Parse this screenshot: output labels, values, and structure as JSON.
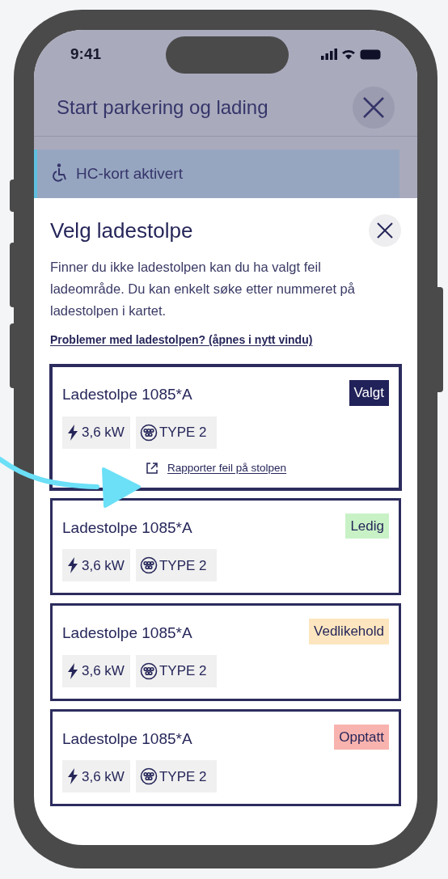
{
  "status_bar": {
    "time": "9:41"
  },
  "background": {
    "title": "Start parkering og lading",
    "banner": {
      "title": "HC-kort aktivert"
    }
  },
  "sheet": {
    "title": "Velg ladestolpe",
    "description": "Finner du ikke ladestolpen kan du ha valgt feil ladeområde. Du kan enkelt søke etter nummeret på ladestolpen i kartet.",
    "help_link": "Problemer med ladestolpen? (åpnes i nytt vindu)",
    "chargers": [
      {
        "name": "Ladestolpe 1085*A",
        "selected": true,
        "status": {
          "label": "Valgt",
          "kind": "selected"
        },
        "power": "3,6 kW",
        "connector": "TYPE 2",
        "report_link": "Rapporter feil på stolpen"
      },
      {
        "name": "Ladestolpe 1085*A",
        "selected": false,
        "status": {
          "label": "Ledig",
          "kind": "free"
        },
        "power": "3,6 kW",
        "connector": "TYPE 2"
      },
      {
        "name": "Ladestolpe 1085*A",
        "selected": false,
        "status": {
          "label": "Vedlikehold",
          "kind": "maintenance"
        },
        "power": "3,6 kW",
        "connector": "TYPE 2"
      },
      {
        "name": "Ladestolpe 1085*A",
        "selected": false,
        "status": {
          "label": "Opptatt",
          "kind": "busy"
        },
        "power": "3,6 kW",
        "connector": "TYPE 2"
      }
    ]
  }
}
